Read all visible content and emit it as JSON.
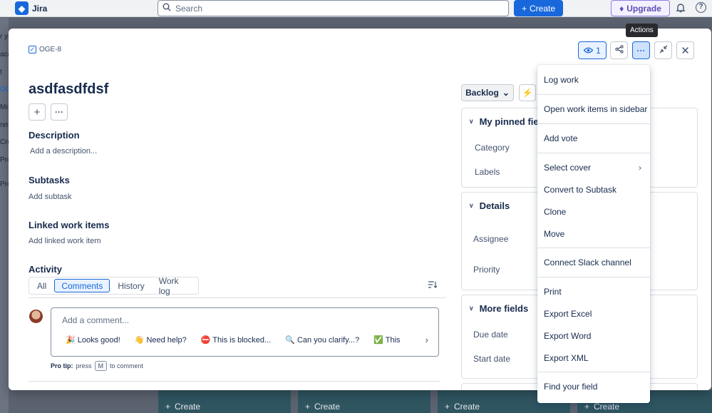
{
  "topnav": {
    "app_name": "Jira",
    "search_placeholder": "Search",
    "create_label": "Create",
    "upgrade_label": "Upgrade"
  },
  "background": {
    "sidebar_fragments": [
      "r yo",
      "ace",
      "t",
      "OGE",
      "Mor",
      "nm",
      "Cre",
      "Pro",
      "Pre"
    ],
    "create_labels": [
      "Create",
      "Create",
      "Create",
      "Create"
    ]
  },
  "issue": {
    "key": "OGE-8",
    "watch_count": "1",
    "tooltip": "Actions",
    "title": "asdfasdfdsf",
    "description_heading": "Description",
    "description_placeholder": "Add a description...",
    "subtasks_heading": "Subtasks",
    "add_subtask": "Add subtask",
    "linked_heading": "Linked work items",
    "add_linked": "Add linked work item"
  },
  "activity": {
    "heading": "Activity",
    "tabs": [
      "All",
      "Comments",
      "History",
      "Work log"
    ],
    "active_tab": "Comments",
    "comment_placeholder": "Add a comment...",
    "chips": [
      "🎉 Looks good!",
      "👋 Need help?",
      "⛔ This is blocked...",
      "🔍 Can you clarify...?",
      "✅ This"
    ],
    "protip_label": "Pro tip:",
    "protip_press": "press",
    "protip_key": "M",
    "protip_suffix": "to comment"
  },
  "sidebar": {
    "status": "Backlog",
    "pinned_heading": "My pinned fie",
    "pinned_fields": [
      "Category",
      "Labels"
    ],
    "details_heading": "Details",
    "details_fields": [
      "Assignee",
      "Priority"
    ],
    "more_heading": "More fields",
    "more_fields": [
      "Due date",
      "Start date"
    ]
  },
  "menu": {
    "items": [
      "Log work",
      "Open work items in sidebar",
      "Add vote",
      "Select cover",
      "Convert to Subtask",
      "Clone",
      "Move",
      "Connect Slack channel",
      "Print",
      "Export Excel",
      "Export Word",
      "Export XML",
      "Find your field"
    ]
  }
}
